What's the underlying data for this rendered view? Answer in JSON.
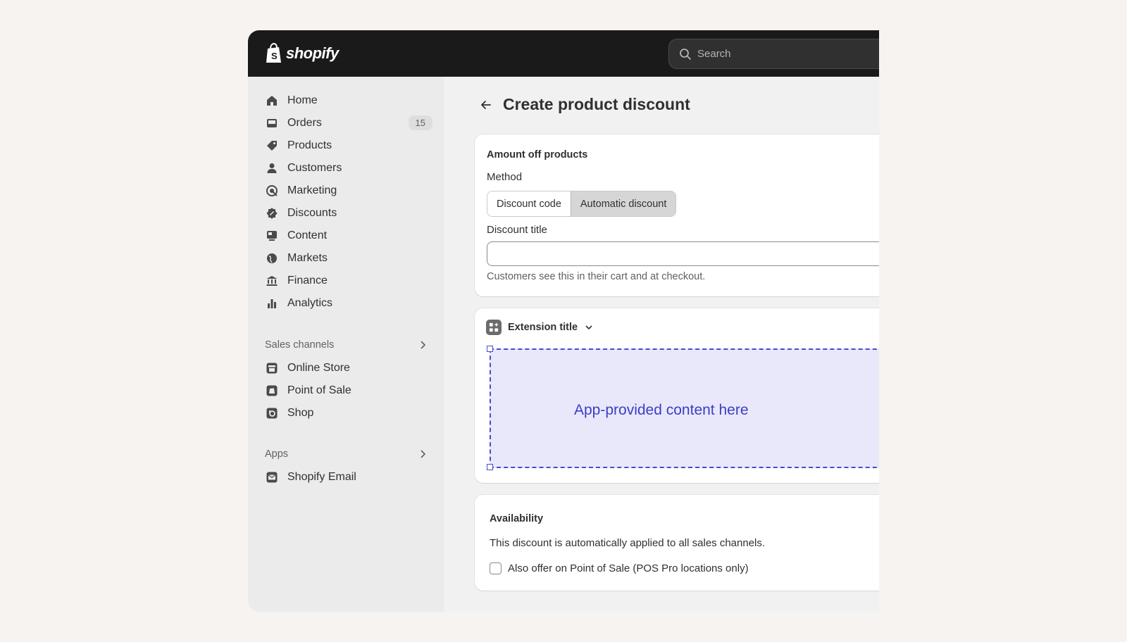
{
  "app": {
    "logo_text": "shopify",
    "search_placeholder": "Search"
  },
  "sidebar": {
    "items": [
      {
        "label": "Home",
        "icon": "home-icon"
      },
      {
        "label": "Orders",
        "icon": "inbox-icon",
        "badge": "15"
      },
      {
        "label": "Products",
        "icon": "tag-icon"
      },
      {
        "label": "Customers",
        "icon": "person-icon"
      },
      {
        "label": "Marketing",
        "icon": "target-icon"
      },
      {
        "label": "Discounts",
        "icon": "discount-icon"
      },
      {
        "label": "Content",
        "icon": "content-icon"
      },
      {
        "label": "Markets",
        "icon": "globe-icon"
      },
      {
        "label": "Finance",
        "icon": "bank-icon"
      },
      {
        "label": "Analytics",
        "icon": "bar-chart-icon"
      }
    ],
    "sales_channels": {
      "label": "Sales channels",
      "items": [
        {
          "label": "Online Store",
          "icon": "store-icon"
        },
        {
          "label": "Point of Sale",
          "icon": "pos-icon"
        },
        {
          "label": "Shop",
          "icon": "shop-icon"
        }
      ]
    },
    "apps": {
      "label": "Apps",
      "items": [
        {
          "label": "Shopify Email",
          "icon": "email-icon"
        }
      ]
    }
  },
  "page": {
    "title": "Create product discount"
  },
  "discount_card": {
    "title": "Amount off products",
    "method_label": "Method",
    "method_options": [
      "Discount code",
      "Automatic discount"
    ],
    "method_selected": "Automatic discount",
    "title_field_label": "Discount title",
    "title_field_value": "",
    "help_text": "Customers see this in their cart and at checkout."
  },
  "extension_card": {
    "title": "Extension title",
    "placeholder": "App-provided content here"
  },
  "availability_card": {
    "title": "Availability",
    "description": "This discount is automatically applied to all sales channels.",
    "checkbox_label": "Also offer on Point of Sale (POS Pro locations only)",
    "checkbox_checked": false
  },
  "colors": {
    "topbar": "#1a1a1a",
    "sidebar": "#ebebeb",
    "accent": "#3d3dc6",
    "placeholder_bg": "#e9e8fb"
  }
}
